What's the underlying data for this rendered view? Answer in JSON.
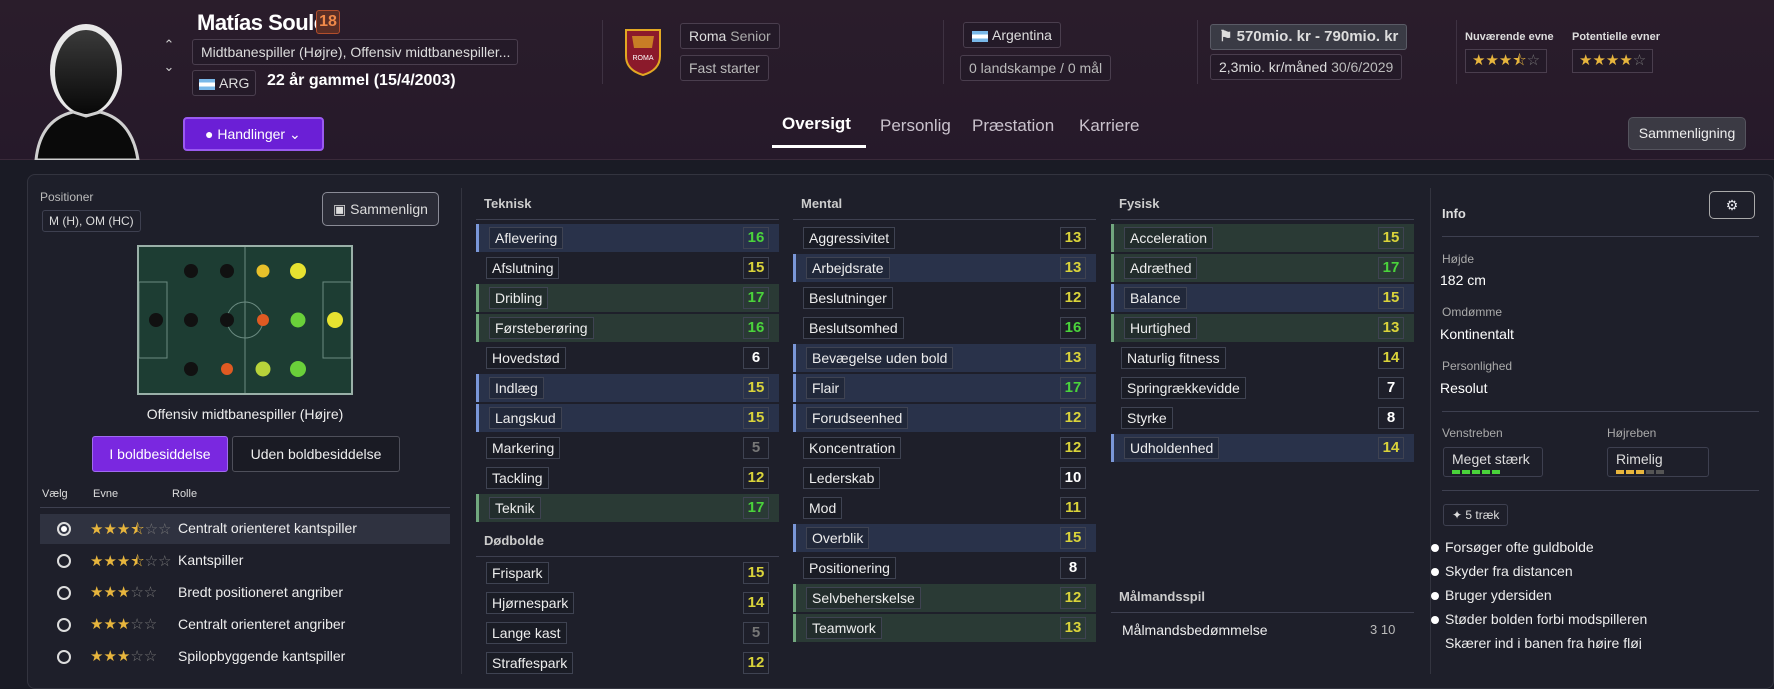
{
  "header": {
    "player_name": "Matías Soulé",
    "squad_number": "18",
    "positions_text": "Midtbanespiller (Højre), Offensiv midtbanespiller...",
    "nationality_code": "ARG",
    "age_text": "22 år gammel (15/4/2003)",
    "club": "Roma",
    "club_team": "Senior",
    "personality_tag": "Fast starter",
    "nation": "Argentina",
    "caps_text": "0 landskampe / 0 mål",
    "value_text": "570mio. kr - 790mio. kr",
    "wage_text": "2,3mio. kr/måned",
    "contract_end": "30/6/2029",
    "current_ability_label": "Nuværende evne",
    "potential_ability_label": "Potentielle evner",
    "current_ability_stars": 3.5,
    "potential_ability_stars": 4,
    "actions_label": "Handlinger",
    "compare_label": "Sammenligning",
    "tabs": [
      "Oversigt",
      "Personlig",
      "Præstation",
      "Karriere"
    ],
    "active_tab": "Oversigt"
  },
  "left": {
    "positions_label": "Positioner",
    "positions_value": "M (H), OM (HC)",
    "compare_btn": "Sammenlign",
    "role_title": "Offensiv midtbanespiller (Højre)",
    "in_possession": "I boldbesiddelse",
    "out_possession": "Uden boldbesiddelse",
    "col_select": "Vælg",
    "col_ability": "Evne",
    "col_role": "Rolle",
    "roles": [
      {
        "name": "Centralt orienteret kantspiller",
        "stars": 3.5,
        "selected": true
      },
      {
        "name": "Kantspiller",
        "stars": 3.5,
        "selected": false
      },
      {
        "name": "Bredt positioneret angriber",
        "stars": 3,
        "selected": false
      },
      {
        "name": "Centralt orienteret angriber",
        "stars": 3,
        "selected": false
      },
      {
        "name": "Spilopbyggende kantspiller",
        "stars": 3,
        "selected": false
      }
    ]
  },
  "technical": {
    "title": "Teknisk",
    "attrs": [
      {
        "name": "Aflevering",
        "value": "16",
        "hl": "blue"
      },
      {
        "name": "Afslutning",
        "value": "15",
        "hl": ""
      },
      {
        "name": "Dribling",
        "value": "17",
        "hl": "green"
      },
      {
        "name": "Førsteberøring",
        "value": "16",
        "hl": "green"
      },
      {
        "name": "Hovedstød",
        "value": "6",
        "hl": ""
      },
      {
        "name": "Indlæg",
        "value": "15",
        "hl": "blue"
      },
      {
        "name": "Langskud",
        "value": "15",
        "hl": "blue"
      },
      {
        "name": "Markering",
        "value": "5",
        "hl": ""
      },
      {
        "name": "Tackling",
        "value": "12",
        "hl": ""
      },
      {
        "name": "Teknik",
        "value": "17",
        "hl": "green"
      }
    ],
    "set_pieces_title": "Dødbolde",
    "set_pieces": [
      {
        "name": "Frispark",
        "value": "15",
        "hl": ""
      },
      {
        "name": "Hjørnespark",
        "value": "14",
        "hl": ""
      },
      {
        "name": "Lange kast",
        "value": "5",
        "hl": ""
      },
      {
        "name": "Straffespark",
        "value": "12",
        "hl": ""
      }
    ]
  },
  "mental": {
    "title": "Mental",
    "attrs": [
      {
        "name": "Aggressivitet",
        "value": "13",
        "hl": ""
      },
      {
        "name": "Arbejdsrate",
        "value": "13",
        "hl": "blue"
      },
      {
        "name": "Beslutninger",
        "value": "12",
        "hl": ""
      },
      {
        "name": "Beslutsomhed",
        "value": "16",
        "hl": ""
      },
      {
        "name": "Bevægelse uden bold",
        "value": "13",
        "hl": "blue"
      },
      {
        "name": "Flair",
        "value": "17",
        "hl": "blue"
      },
      {
        "name": "Forudseenhed",
        "value": "12",
        "hl": "blue"
      },
      {
        "name": "Koncentration",
        "value": "12",
        "hl": ""
      },
      {
        "name": "Lederskab",
        "value": "10",
        "hl": ""
      },
      {
        "name": "Mod",
        "value": "11",
        "hl": ""
      },
      {
        "name": "Overblik",
        "value": "15",
        "hl": "blue"
      },
      {
        "name": "Positionering",
        "value": "8",
        "hl": ""
      },
      {
        "name": "Selvbeherskelse",
        "value": "12",
        "hl": "green"
      },
      {
        "name": "Teamwork",
        "value": "13",
        "hl": "green"
      }
    ]
  },
  "physical": {
    "title": "Fysisk",
    "attrs": [
      {
        "name": "Acceleration",
        "value": "15",
        "hl": "green"
      },
      {
        "name": "Adræthed",
        "value": "17",
        "hl": "green"
      },
      {
        "name": "Balance",
        "value": "15",
        "hl": "blue"
      },
      {
        "name": "Hurtighed",
        "value": "13",
        "hl": "green"
      },
      {
        "name": "Naturlig fitness",
        "value": "14",
        "hl": ""
      },
      {
        "name": "Springrækkevidde",
        "value": "7",
        "hl": ""
      },
      {
        "name": "Styrke",
        "value": "8",
        "hl": ""
      },
      {
        "name": "Udholdenhed",
        "value": "14",
        "hl": "blue"
      }
    ],
    "gk_title": "Målmandsspil",
    "gk_label": "Målmandsbedømmelse",
    "gk_value": "3 10"
  },
  "info": {
    "title": "Info",
    "height_label": "Højde",
    "height": "182 cm",
    "rep_label": "Omdømme",
    "rep": "Kontinentalt",
    "pers_label": "Personlighed",
    "pers": "Resolut",
    "left_foot_label": "Venstreben",
    "left_foot": "Meget stærk",
    "left_foot_level": 5,
    "right_foot_label": "Højreben",
    "right_foot": "Rimelig",
    "right_foot_level": 3,
    "traits_btn": "5 træk",
    "traits": [
      "Forsøger ofte guldbolde",
      "Skyder fra distancen",
      "Bruger ydersiden",
      "Støder bolden forbi modspilleren",
      "Skærer ind i banen fra højre fløj"
    ]
  },
  "colors": {
    "green": "#4ad33b",
    "yellow": "#d9d33a",
    "orange": "#e05a22",
    "accent": "#6b1fd6"
  }
}
